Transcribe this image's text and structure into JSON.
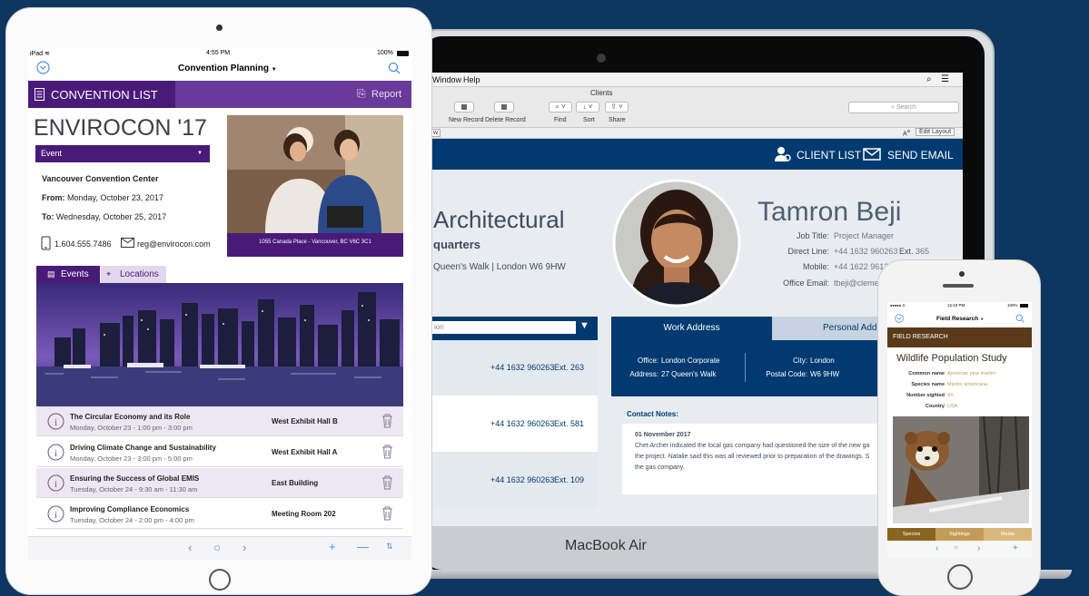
{
  "mac": {
    "brand": "MacBook Air",
    "menubar": {
      "items": [
        "Window",
        "Help"
      ]
    },
    "window_title": "Clients",
    "toolbar": {
      "new_record": "New Record",
      "delete_record": "Delete Record",
      "find": "Find",
      "sort": "Sort",
      "share": "Share",
      "search_placeholder": "Search"
    },
    "layoutbar": {
      "view_label": "w",
      "edit_layout": "Edit Layout",
      "font_size_icon": "A"
    },
    "header": {
      "client_list": "CLIENT LIST",
      "send_email": "SEND EMAIL"
    },
    "company": {
      "name": "Architectural",
      "subtitle": "quarters",
      "address": "Queen's Walk | London W6 9HW"
    },
    "person": {
      "name": "Tamron Beji",
      "fields": [
        {
          "label": "Job Title:",
          "value": "Project Manager"
        },
        {
          "label": "Direct Line:",
          "value": "+44 1632 960263",
          "ext_label": "Ext.",
          "ext": "365"
        },
        {
          "label": "Mobile:",
          "value": "+44 1622 961279"
        },
        {
          "label": "Office Email:",
          "value": "tbeji@clementarc.uk"
        }
      ]
    },
    "dropdown_text": "ion",
    "contacts": [
      {
        "phone": "+44 1632 960263",
        "ext": "Ext. 263"
      },
      {
        "phone": "+44 1632 960263",
        "ext": "Ext. 581"
      },
      {
        "phone": "+44 1632 960263",
        "ext": "Ext. 109"
      }
    ],
    "tabs": {
      "work": "Work Address",
      "personal": "Personal Addr"
    },
    "address": {
      "office_label": "Office:",
      "office": "London Corporate",
      "address_label": "Address:",
      "address": "27 Queen's Walk",
      "city_label": "City:",
      "city": "London",
      "postal_label": "Postal Code:",
      "postal": "W6 9HW"
    },
    "notes": {
      "title": "Contact Notes:",
      "date": "01 November 2017",
      "lines": [
        "Chet Archer indicated the local gas company had questioned the size of the new ga",
        "the project. Natalie said this was all reviewed prior to preparation of the drawings. S",
        "the gas company."
      ]
    }
  },
  "ipad": {
    "status": {
      "carrier": "iPad",
      "time": "4:55 PM",
      "battery": "100%"
    },
    "nav": {
      "title": "Convention Planning"
    },
    "banner": {
      "title": "CONVENTION LIST",
      "report": "Report"
    },
    "event": {
      "title": "ENVIROCON '17",
      "type_select": "Event",
      "venue": "Vancouver Convention Center",
      "from_label": "From:",
      "from": "Monday, October 23, 2017",
      "to_label": "To:",
      "to": "Wednesday, October 25, 2017",
      "phone": "1.604.555.7486",
      "email": "reg@envirocon.com",
      "photo_caption": "1055 Canada Place - Vancouver, BC V6C 3C1"
    },
    "tabs": {
      "events": "Events",
      "locations": "Locations"
    },
    "sessions": [
      {
        "title": "The Circular Economy and its Role",
        "time": "Monday, October 23 - 1:00 pm - 3:00 pm",
        "room": "West Exhibit Hall B"
      },
      {
        "title": "Driving Climate Change and Sustainability",
        "time": "Monday, October 23 - 3:00 pm - 5:00 pm",
        "room": "West Exhibit Hall A"
      },
      {
        "title": "Ensuring the Success of Global EMIS",
        "time": "Tuesday, October 24 - 9:30 am - 11:30 am",
        "room": "East Building"
      },
      {
        "title": "Improving Compliance Economics",
        "time": "Tuesday, October 24 - 2:00 pm - 4:00 pm",
        "room": "Meeting Room 202"
      }
    ]
  },
  "iphone": {
    "status": {
      "time": "12:43 PM",
      "battery": "100%"
    },
    "nav": {
      "title": "Field Research"
    },
    "banner": "FIELD RESEARCH",
    "title": "Wildlife Population Study",
    "fields": [
      {
        "label": "Common name",
        "value": "American pine marten"
      },
      {
        "label": "Species name",
        "value": "Martes americana"
      },
      {
        "label": "Number sighted",
        "value": "43"
      },
      {
        "label": "Country",
        "value": "USA"
      }
    ],
    "tabs": [
      "Species",
      "Sightings",
      "Media"
    ]
  },
  "colors": {
    "background": "#0d3660",
    "ipad_purple": "#4a1a78",
    "mac_navy": "#003a70",
    "iphone_brown": "#5a3a1a",
    "iphone_gold": "#c49c58"
  }
}
